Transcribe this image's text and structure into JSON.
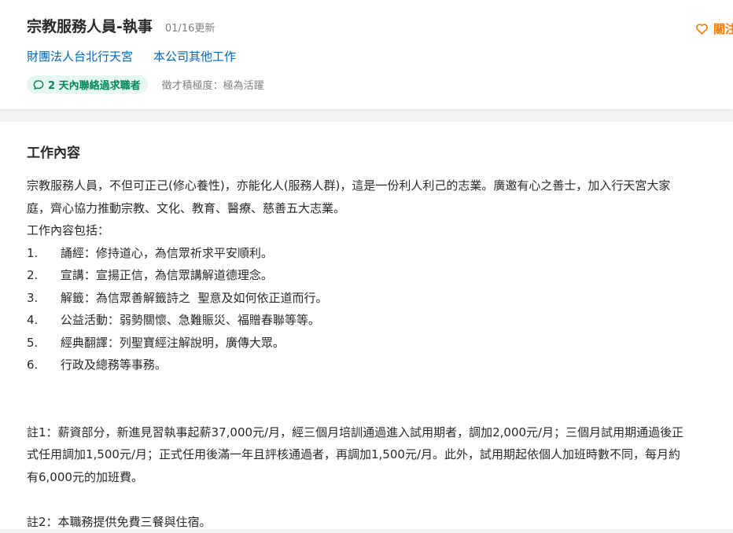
{
  "header": {
    "title": "宗教服務人員-執事",
    "update_date": "01/16更新",
    "follow_label": "關注",
    "company_name": "財團法人台北行天宮",
    "other_jobs_label": "本公司其他工作",
    "contact_badge": "2 天內聯絡過求職者",
    "activity_text": "徵才積極度：極為活躍"
  },
  "content": {
    "section_title": "工作內容",
    "description": "宗教服務人員，不但可正己(修心養性)，亦能化人(服務人群)，這是一份利人利己的志業。廣邀有心之善士，加入行天宮大家\n庭，齊心協力推動宗教、文化、教育、醫療、慈善五大志業。\n工作內容包括：\n1.      誦經：修持道心，為信眾祈求平安順利。\n2.      宣講：宣揚正信，為信眾講解道德理念。\n3.      解籤：為信眾善解籤詩之  聖意及如何依正道而行。\n4.      公益活動：弱勢關懷、急難賑災、福贈春聯等等。\n5.      經典翻譯：列聖寶經注解說明，廣傳大眾。\n6.      行政及總務等事務。\n\n\n註1：薪資部分，新進見習執事起薪37,000元/月，經三個月培訓通過進入試用期者，調加2,000元/月；三個月試用期通過後正\n式任用調加1,500元/月；正式任用後滿一年且評核通過者，再調加1,500元/月。此外，試用期起依個人加班時數不同，每月約\n有6,000元的加班費。\n\n註2：本職務提供免費三餐與住宿。"
  },
  "colors": {
    "accent_orange": "#ff7800",
    "link_blue": "#0066b8",
    "badge_green": "#00875a",
    "badge_bg": "#e6f6f1"
  }
}
